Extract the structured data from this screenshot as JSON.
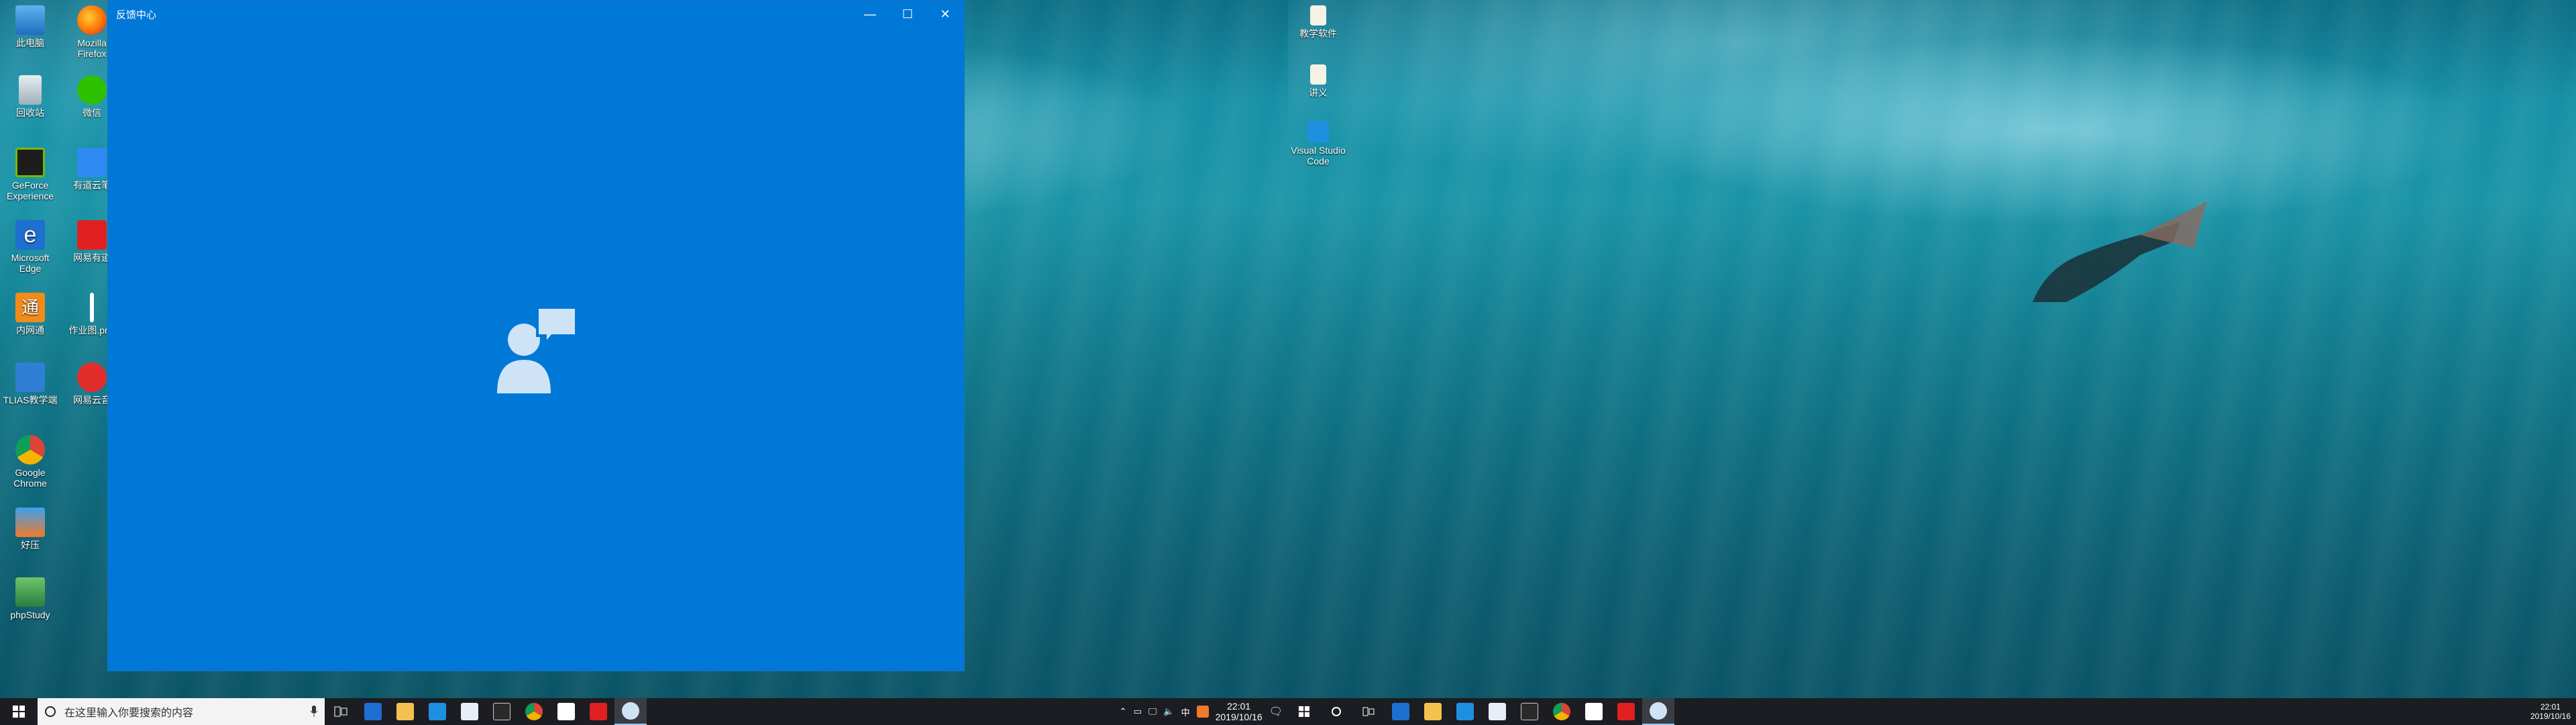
{
  "left_desktop": {
    "icons": [
      {
        "label": "此电脑",
        "icon": "this-pc-icon"
      },
      {
        "label": "Mozilla Firefox",
        "icon": "firefox-icon"
      },
      {
        "label": "回收站",
        "icon": "recycle-bin-icon"
      },
      {
        "label": "微信",
        "icon": "wechat-icon"
      },
      {
        "label": "GeForce Experience",
        "icon": "geforce-icon"
      },
      {
        "label": "有道云笔",
        "icon": "youdao-note-icon"
      },
      {
        "label": "Microsoft Edge",
        "icon": "edge-icon"
      },
      {
        "label": "网易有道",
        "icon": "youdao-dict-icon"
      },
      {
        "label": "内网通",
        "icon": "neiwangtong-icon"
      },
      {
        "label": "作业图.png",
        "icon": "png-file-icon"
      },
      {
        "label": "TLIAS教学端",
        "icon": "tlias-icon"
      },
      {
        "label": "网易云音",
        "icon": "netease-music-icon"
      },
      {
        "label": "Google Chrome",
        "icon": "chrome-icon"
      },
      {
        "label": "好压",
        "icon": "haozip-icon"
      },
      {
        "label": "phpStudy",
        "icon": "phpstudy-icon"
      }
    ]
  },
  "right_desktop": {
    "icons": [
      {
        "label": "教学软件",
        "icon": "file-icon"
      },
      {
        "label": "讲义",
        "icon": "file-icon"
      },
      {
        "label": "Visual Studio Code",
        "icon": "vscode-icon"
      }
    ]
  },
  "window": {
    "title": "反馈中心",
    "minimize": "—",
    "maximize": "☐",
    "close": "✕",
    "splash_icon": "feedback-hub-icon",
    "background_color": "#0078d7"
  },
  "taskbar_left": {
    "search_placeholder": "在这里输入你要搜索的内容",
    "ime": "中",
    "time": "22:01",
    "date": "2019/10/16",
    "apps": [
      "edge",
      "file-explorer",
      "vscode",
      "notepad",
      "terminal",
      "chrome",
      "photos",
      "youdao",
      "feedback-hub"
    ]
  },
  "taskbar_right": {
    "time": "22:01",
    "date": "2019/10/16"
  }
}
